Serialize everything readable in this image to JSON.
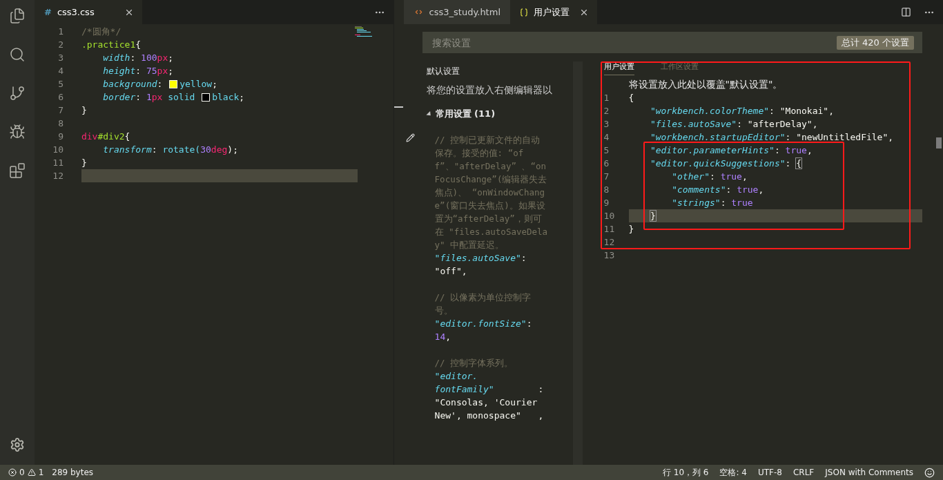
{
  "activity_bar": {
    "items": [
      {
        "kind": "files"
      },
      {
        "kind": "search"
      },
      {
        "kind": "git"
      },
      {
        "kind": "debug"
      },
      {
        "kind": "extensions"
      }
    ]
  },
  "left_editor": {
    "tabs": [
      {
        "icon": "#",
        "label": "css3.css",
        "selected": true
      }
    ],
    "lines": [
      {
        "number": "1",
        "current": false,
        "tokens": [
          {
            "kind": "comment",
            "text": "/*圆角*/"
          }
        ]
      },
      {
        "number": "2",
        "current": false,
        "tokens": [
          {
            "kind": "selector",
            "text": ".practice1"
          },
          {
            "kind": "punct",
            "text": "{"
          }
        ]
      },
      {
        "number": "3",
        "current": false,
        "tokens": [
          {
            "kind": "property",
            "text": "    width"
          },
          {
            "kind": "punct",
            "text": ": "
          },
          {
            "kind": "number",
            "text": "100"
          },
          {
            "kind": "unit",
            "text": "px"
          },
          {
            "kind": "punct",
            "text": ";"
          }
        ]
      },
      {
        "number": "4",
        "current": false,
        "tokens": [
          {
            "kind": "property",
            "text": "    height"
          },
          {
            "kind": "punct",
            "text": ": "
          },
          {
            "kind": "number",
            "text": "75"
          },
          {
            "kind": "unit",
            "text": "px"
          },
          {
            "kind": "punct",
            "text": ";"
          }
        ]
      },
      {
        "number": "5",
        "current": false,
        "tokens": [
          {
            "kind": "property",
            "text": "    background"
          },
          {
            "kind": "punct",
            "text": ": "
          },
          {
            "kind": "swatch",
            "color": "#ffff00"
          },
          {
            "kind": "value",
            "text": "yellow"
          },
          {
            "kind": "punct",
            "text": ";"
          }
        ]
      },
      {
        "number": "6",
        "current": false,
        "tokens": [
          {
            "kind": "property",
            "text": "    border"
          },
          {
            "kind": "punct",
            "text": ": "
          },
          {
            "kind": "number",
            "text": "1"
          },
          {
            "kind": "unit",
            "text": "px"
          },
          {
            "kind": "value",
            "text": " solid "
          },
          {
            "kind": "swatch",
            "color": "#000000"
          },
          {
            "kind": "value",
            "text": "black"
          },
          {
            "kind": "punct",
            "text": ";"
          }
        ]
      },
      {
        "number": "7",
        "current": false,
        "tokens": [
          {
            "kind": "punct",
            "text": "}"
          }
        ]
      },
      {
        "number": "8",
        "current": false
      },
      {
        "number": "9",
        "current": false,
        "tokens": [
          {
            "kind": "tag",
            "text": "div"
          },
          {
            "kind": "selector",
            "text": "#div2"
          },
          {
            "kind": "punct",
            "text": "{"
          }
        ]
      },
      {
        "number": "10",
        "current": false,
        "tokens": [
          {
            "kind": "property",
            "text": "    transform"
          },
          {
            "kind": "punct",
            "text": ": "
          },
          {
            "kind": "value",
            "text": "rotate("
          },
          {
            "kind": "number",
            "text": "30"
          },
          {
            "kind": "unit",
            "text": "deg"
          },
          {
            "kind": "punct",
            "text": ");"
          }
        ]
      },
      {
        "number": "11",
        "current": false,
        "tokens": [
          {
            "kind": "punct",
            "text": "}"
          }
        ]
      },
      {
        "number": "12",
        "current": true
      }
    ]
  },
  "right_editor": {
    "tabs": [
      {
        "kind": "html",
        "label": "css3_study.html",
        "selected": false
      },
      {
        "kind": "json",
        "label": "用户设置",
        "selected": true
      }
    ],
    "search": {
      "placeholder": "搜索设置",
      "count": "总计 420 个设置"
    },
    "default_settings": {
      "title": "默认设置",
      "description": "将您的设置放入右侧编辑器以",
      "section": {
        "label": "常用设置 (11)",
        "expanded": true
      },
      "entries": [
        {
          "edit_icon": true,
          "comment": "// 控制已更新文件的自动保存。接受的值: “off”、\"afterDelay” 、“onFocusChange”(编辑器失去焦点)、 “onWindowChange”(窗口失去焦点)。如果设置为“afterDelay”，则可在 \"files.autoSaveDelay\" 中配置延迟。",
          "key_tokens": [
            {
              "kind": "key",
              "text": "\"files.autoSave\""
            },
            {
              "kind": "punct",
              "text": ":"
            }
          ],
          "value_tokens": [
            {
              "kind": "string",
              "text": "\"off\""
            },
            {
              "kind": "punct",
              "text": ","
            }
          ]
        },
        {
          "edit_icon": false,
          "comment": "// 以像素为单位控制字号。",
          "key_tokens": [
            {
              "kind": "key",
              "text": "\"editor.fontSize\""
            },
            {
              "kind": "punct",
              "text": ":"
            }
          ],
          "value_tokens": [
            {
              "kind": "number",
              "text": "14"
            },
            {
              "kind": "punct",
              "text": ","
            }
          ]
        },
        {
          "edit_icon": false,
          "comment": "// 控制字体系列。",
          "key_tokens": [
            {
              "kind": "key",
              "text": "\"editor. fontFamily\""
            },
            {
              "kind": "punct",
              "text": ":"
            }
          ],
          "value_tokens": [
            {
              "kind": "string",
              "text": "\"Consolas, 'Courier New', monospace\""
            },
            {
              "kind": "punct",
              "text": ","
            }
          ]
        }
      ]
    },
    "user_settings": {
      "tabs": [
        {
          "label": "用户设置",
          "selected": true
        },
        {
          "label": "工作区设置",
          "selected": false
        }
      ],
      "hint": "将设置放入此处以覆盖\"默认设置\"。",
      "lines": [
        {
          "number": "1",
          "current": false,
          "tokens": [
            {
              "kind": "punct",
              "text": "{"
            }
          ]
        },
        {
          "number": "2",
          "current": false,
          "tokens": [
            {
              "kind": "key",
              "text": "    \"workbench.colorTheme\""
            },
            {
              "kind": "punct",
              "text": ": "
            },
            {
              "kind": "string",
              "text": "\"Monokai\""
            },
            {
              "kind": "punct",
              "text": ","
            }
          ]
        },
        {
          "number": "3",
          "current": false,
          "tokens": [
            {
              "kind": "key",
              "text": "    \"files.autoSave\""
            },
            {
              "kind": "punct",
              "text": ": "
            },
            {
              "kind": "string",
              "text": "\"afterDelay\""
            },
            {
              "kind": "punct",
              "text": ","
            }
          ]
        },
        {
          "number": "4",
          "current": false,
          "tokens": [
            {
              "kind": "key",
              "text": "    \"workbench.startupEditor\""
            },
            {
              "kind": "punct",
              "text": ": "
            },
            {
              "kind": "string",
              "text": "\"newUntitledFile\""
            },
            {
              "kind": "punct",
              "text": ","
            }
          ]
        },
        {
          "number": "5",
          "current": false,
          "tokens": [
            {
              "kind": "key",
              "text": "    \"editor.parameterHints\""
            },
            {
              "kind": "punct",
              "text": ": "
            },
            {
              "kind": "number",
              "text": "true"
            },
            {
              "kind": "punct",
              "text": ","
            }
          ]
        },
        {
          "number": "6",
          "current": false,
          "tokens": [
            {
              "kind": "key",
              "text": "    \"editor.quickSuggestions\""
            },
            {
              "kind": "punct",
              "text": ": "
            },
            {
              "kind": "bracket",
              "text": "{"
            }
          ]
        },
        {
          "number": "7",
          "current": false,
          "tokens": [
            {
              "kind": "key",
              "text": "        \"other\""
            },
            {
              "kind": "punct",
              "text": ": "
            },
            {
              "kind": "number",
              "text": "true"
            },
            {
              "kind": "punct",
              "text": ","
            }
          ]
        },
        {
          "number": "8",
          "current": false,
          "tokens": [
            {
              "kind": "key",
              "text": "        \"comments\""
            },
            {
              "kind": "punct",
              "text": ": "
            },
            {
              "kind": "number",
              "text": "true"
            },
            {
              "kind": "punct",
              "text": ","
            }
          ]
        },
        {
          "number": "9",
          "current": false,
          "tokens": [
            {
              "kind": "key",
              "text": "        \"strings\""
            },
            {
              "kind": "punct",
              "text": ": "
            },
            {
              "kind": "number",
              "text": "true"
            }
          ]
        },
        {
          "number": "10",
          "current": true,
          "tokens": [
            {
              "kind": "bracket",
              "text": "    }"
            }
          ]
        },
        {
          "number": "11",
          "current": false,
          "tokens": [
            {
              "kind": "punct",
              "text": "}"
            }
          ]
        },
        {
          "number": "12",
          "current": false
        },
        {
          "number": "13",
          "current": false
        }
      ]
    }
  },
  "status_bar": {
    "errors": "0",
    "warnings": "1",
    "size": "289 bytes",
    "right": [
      "行 10，列 6",
      "空格: 4",
      "UTF-8",
      "CRLF",
      "JSON with Comments"
    ]
  }
}
